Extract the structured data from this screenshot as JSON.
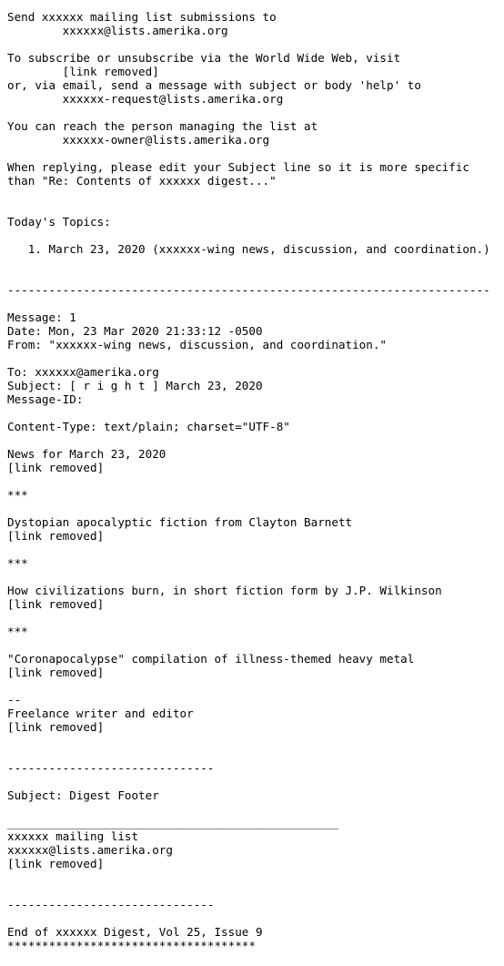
{
  "document": {
    "kind": "plain-text-email-digest",
    "background_color": "#ffffff",
    "text_color": "#000000",
    "list_name_masked": "xxxxxx",
    "domain": "lists.amerika.org",
    "lines": [
      "Send xxxxxx mailing list submissions to",
      "        xxxxxx@lists.amerika.org",
      "",
      "To subscribe or unsubscribe via the World Wide Web, visit",
      "        [link removed]",
      "or, via email, send a message with subject or body 'help' to",
      "        xxxxxx-request@lists.amerika.org",
      "",
      "You can reach the person managing the list at",
      "        xxxxxx-owner@lists.amerika.org",
      "",
      "When replying, please edit your Subject line so it is more specific",
      "than \"Re: Contents of xxxxxx digest...\"",
      "",
      "",
      "Today's Topics:",
      "",
      "   1. March 23, 2020 (xxxxxx-wing news, discussion, and coordination.)",
      "",
      "",
      "----------------------------------------------------------------------",
      "",
      "Message: 1",
      "Date: Mon, 23 Mar 2020 21:33:12 -0500",
      "From: \"xxxxxx-wing news, discussion, and coordination.\"",
      "",
      "To: xxxxxx@amerika.org",
      "Subject: [ r i g h t ] March 23, 2020",
      "Message-ID:",
      "",
      "Content-Type: text/plain; charset=\"UTF-8\"",
      "",
      "News for March 23, 2020",
      "[link removed]",
      "",
      "***",
      "",
      "Dystopian apocalyptic fiction from Clayton Barnett",
      "[link removed]",
      "",
      "***",
      "",
      "How civilizations burn, in short fiction form by J.P. Wilkinson",
      "[link removed]",
      "",
      "***",
      "",
      "\"Coronapocalypse\" compilation of illness-themed heavy metal",
      "[link removed]",
      "",
      "--",
      "Freelance writer and editor",
      "[link removed]",
      "",
      "",
      "------------------------------",
      "",
      "Subject: Digest Footer",
      "",
      "________________________________________________",
      "xxxxxx mailing list",
      "xxxxxx@lists.amerika.org",
      "[link removed]",
      "",
      "",
      "------------------------------",
      "",
      "End of xxxxxx Digest, Vol 25, Issue 9",
      "************************************"
    ],
    "sections": {
      "submissions_header": {
        "intro": "Send xxxxxx mailing list submissions to",
        "address": "xxxxxx@lists.amerika.org"
      },
      "subscribe_help": {
        "web_intro": "To subscribe or unsubscribe via the World Wide Web, visit",
        "web_link": "[link removed]",
        "email_intro": "or, via email, send a message with subject or body 'help' to",
        "request_address": "xxxxxx-request@lists.amerika.org"
      },
      "owner_contact": {
        "intro": "You can reach the person managing the list at",
        "owner_address": "xxxxxx-owner@lists.amerika.org"
      },
      "reply_advice": {
        "line1": "When replying, please edit your Subject line so it is more specific",
        "line2": "than \"Re: Contents of xxxxxx digest...\""
      },
      "topics": {
        "heading": "Today's Topics:",
        "items": [
          "   1. March 23, 2020 (xxxxxx-wing news, discussion, and coordination.)"
        ]
      },
      "message": {
        "number_label": "Message: 1",
        "date": "Date: Mon, 23 Mar 2020 21:33:12 -0500",
        "from": "From: \"xxxxxx-wing news, discussion, and coordination.\"",
        "to": "To: xxxxxx@amerika.org",
        "subject": "Subject: [ r i g h t ] March 23, 2020",
        "message_id": "Message-ID:",
        "content_type": "Content-Type: text/plain; charset=\"UTF-8\"",
        "body": {
          "news_heading": "News for March 23, 2020",
          "news_link": "[link removed]",
          "star_rule": "***",
          "item1_title": "Dystopian apocalyptic fiction from Clayton Barnett",
          "item1_link": "[link removed]",
          "item2_title": "How civilizations burn, in short fiction form by J.P. Wilkinson",
          "item2_link": "[link removed]",
          "item3_title": "\"Coronapocalypse\" compilation of illness-themed heavy metal",
          "item3_link": "[link removed]",
          "signature_dashes": "--",
          "signature_text": "Freelance writer and editor",
          "signature_link": "[link removed]"
        }
      },
      "digest_footer": {
        "subject": "Subject: Digest Footer",
        "list_name": "xxxxxx mailing list",
        "list_address": "xxxxxx@lists.amerika.org",
        "list_link": "[link removed]"
      },
      "end": {
        "end_line": "End of xxxxxx Digest, Vol 25, Issue 9",
        "asterisk_rule": "************************************"
      }
    },
    "rules": {
      "topic_rule": "----------------------------------------------------------------------",
      "short_rule": "------------------------------",
      "underscore_rule": "________________________________________________"
    }
  }
}
